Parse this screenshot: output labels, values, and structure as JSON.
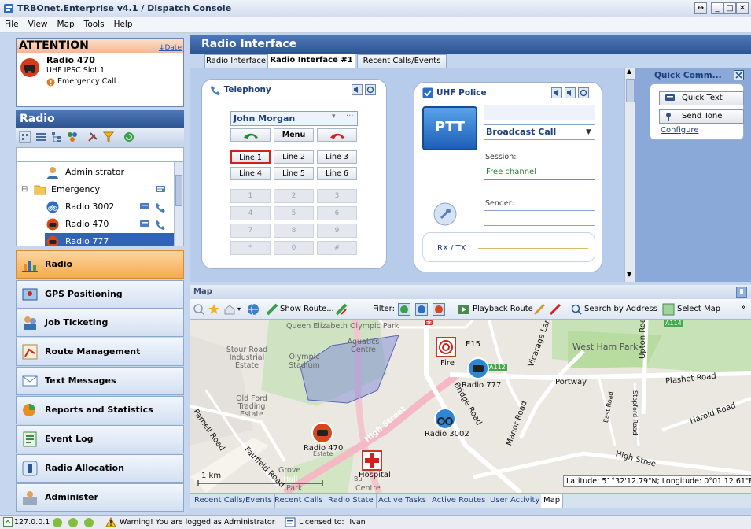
{
  "window": {
    "title": "TRBOnet.Enterprise v4.1 / Dispatch Console"
  },
  "menu": [
    {
      "label": "File"
    },
    {
      "label": "View"
    },
    {
      "label": "Map"
    },
    {
      "label": "Tools"
    },
    {
      "label": "Help"
    }
  ],
  "attention": {
    "title": "ATTENTION",
    "sort_label": "↓Date",
    "radio_name": "Radio 470",
    "slot": "UHF IPSC Slot 1",
    "alert": "Emergency Call"
  },
  "radio_panel": {
    "title": "Radio",
    "tree": [
      {
        "label": "Administrator"
      },
      {
        "label": "Emergency"
      },
      {
        "label": "Radio 3002"
      },
      {
        "label": "Radio 470"
      },
      {
        "label": "Radio 777"
      }
    ]
  },
  "nav": [
    {
      "label": "Radio",
      "icon": "radio-tower-icon"
    },
    {
      "label": "GPS Positioning",
      "icon": "gps-icon"
    },
    {
      "label": "Job Ticketing",
      "icon": "job-ticket-icon"
    },
    {
      "label": "Route Management",
      "icon": "route-icon"
    },
    {
      "label": "Text Messages",
      "icon": "envelope-icon"
    },
    {
      "label": "Reports and Statistics",
      "icon": "report-icon"
    },
    {
      "label": "Event Log",
      "icon": "event-log-icon"
    },
    {
      "label": "Radio Allocation",
      "icon": "allocation-icon"
    },
    {
      "label": "Administer",
      "icon": "admin-icon"
    }
  ],
  "radio_interface": {
    "title": "Radio Interface",
    "tabs": [
      {
        "label": "Radio Interface"
      },
      {
        "label": "Radio Interface #1"
      },
      {
        "label": "Recent Calls/Events"
      }
    ]
  },
  "telephony": {
    "title": "Telephony",
    "contact": "John Morgan",
    "menu_label": "Menu",
    "lines": [
      "Line 1",
      "Line 2",
      "Line 3",
      "Line 4",
      "Line 5",
      "Line 6"
    ],
    "keypad": [
      "1",
      "2",
      "3",
      "4",
      "5",
      "6",
      "7",
      "8",
      "9",
      "*",
      "0",
      "#"
    ]
  },
  "uhf": {
    "title": "UHF Police",
    "ptt_label": "PTT",
    "call_type": "Broadcast Call",
    "session_label": "Session:",
    "session_value": "Free channel",
    "sender_label": "Sender:",
    "rxtx_label": "RX / TX"
  },
  "quick_comm": {
    "title": "Quick Comm...",
    "buttons": [
      {
        "label": "Quick Text"
      },
      {
        "label": "Send Tone"
      }
    ],
    "configure_label": "Configure"
  },
  "map": {
    "title": "Map",
    "toolbar": {
      "show_route": "Show Route...",
      "filter": "Filter:",
      "playback": "Playback Route",
      "search": "Search by Address",
      "select_map": "Select Map"
    },
    "labels": {
      "park": "Queen Elizabeth Olympic Park",
      "aquatics": "Aquatics Centre",
      "stadium": "Olympic Stadium",
      "stour": "Stour Road Industrial Estate",
      "oldford": "Old Ford Trading Estate",
      "parnell": "Parnell Road",
      "fairfield": "Fairfield Road",
      "high_street": "High Street",
      "bridge_road": "Bridge Road",
      "vicarage": "Vicarage Lane",
      "west_ham": "West Ham Park",
      "upton": "Upton Road",
      "portway": "Portway",
      "plashet": "Plashet Road",
      "east_road": "East Road",
      "stopford": "Stopford Road",
      "harold": "Harold Road",
      "manor": "Manor Road",
      "high_street2": "High Stree",
      "e15": "E15",
      "grove": "Grove",
      "hall": "Hall",
      "park2": "Park",
      "centre": "Centre",
      "estate": "Estate",
      "bus": "Bu",
      "a112": "A112",
      "a114": "A114",
      "e3": "E3"
    },
    "markers": {
      "fire": "Fire",
      "radio777": "Radio 777",
      "radio3002": "Radio 3002",
      "radio470": "Radio 470",
      "hospital": "Hospital"
    },
    "scale": "1 km",
    "coords": "Latitude: 51°32'12.79\"N; Longitude: 0°01'12.61\"E",
    "tabs": [
      {
        "label": "Recent Calls/Events"
      },
      {
        "label": "Recent Calls"
      },
      {
        "label": "Radio State"
      },
      {
        "label": "Active Tasks"
      },
      {
        "label": "Active Routes"
      },
      {
        "label": "User Activity"
      },
      {
        "label": "Map"
      }
    ]
  },
  "status": {
    "ip": "127.0.0.1",
    "warning": "Warning! You are logged as Administrator",
    "license": "Licensed to: !Ivan"
  }
}
